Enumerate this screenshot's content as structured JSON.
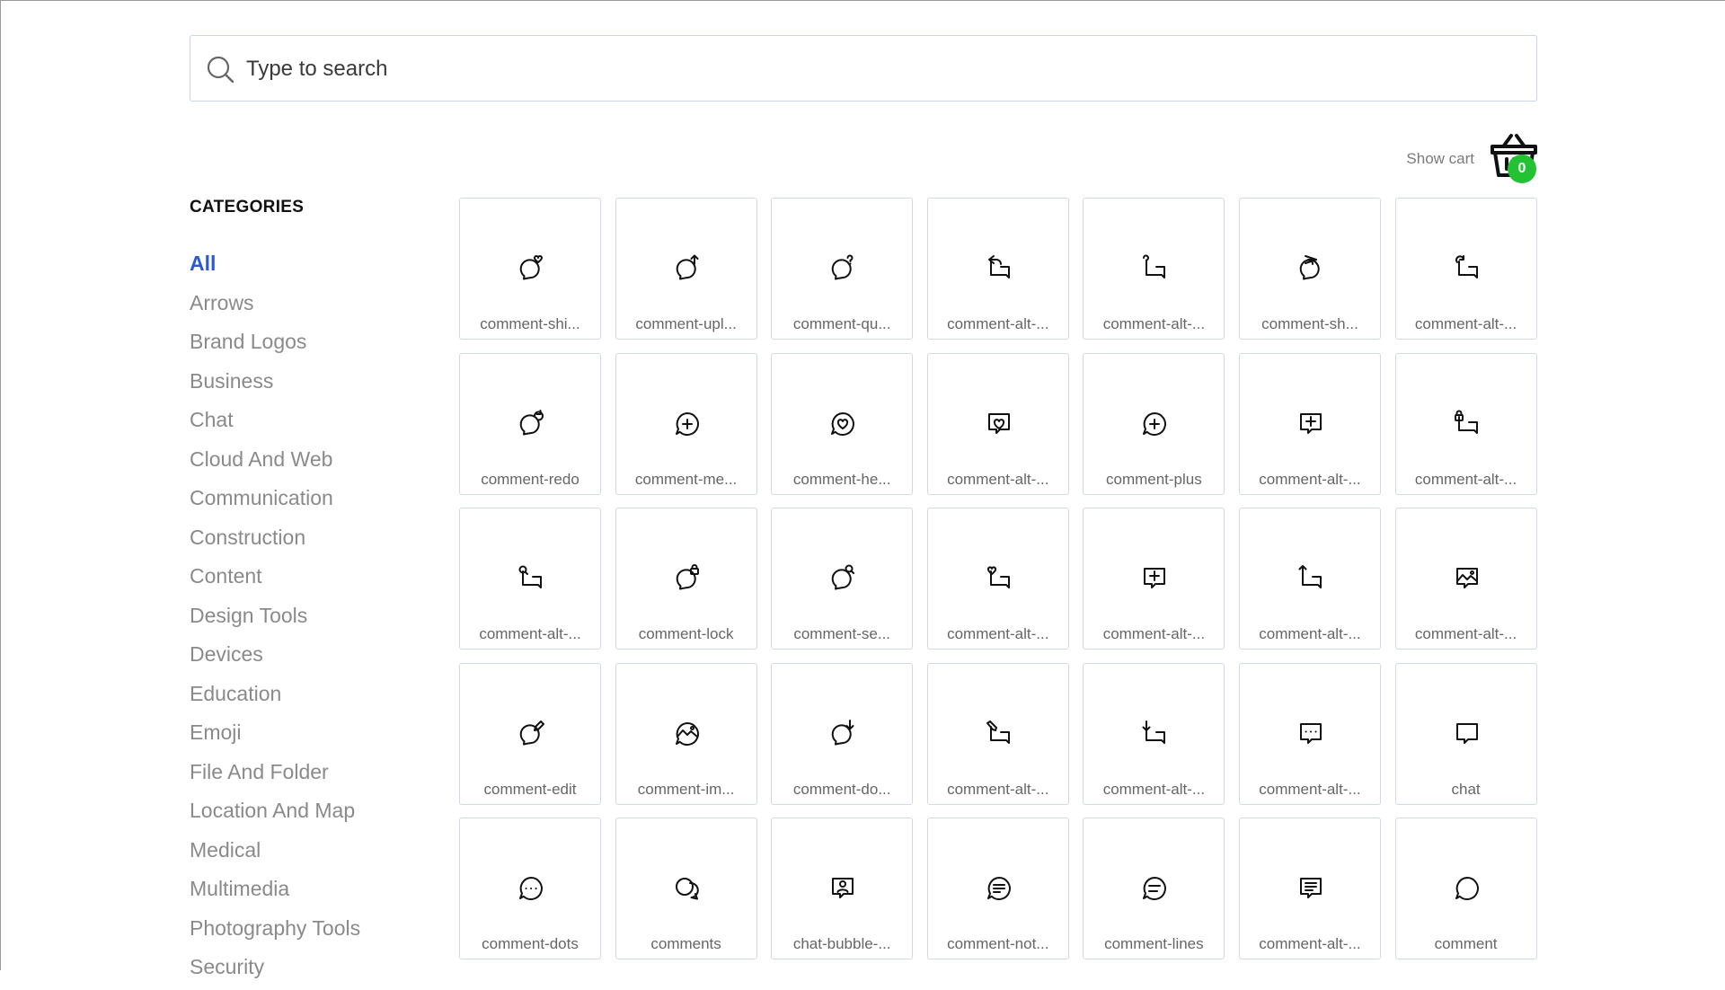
{
  "search": {
    "placeholder": "Type to search"
  },
  "cart": {
    "label": "Show cart",
    "count": "0"
  },
  "categories": {
    "title": "CATEGORIES",
    "items": [
      "All",
      "Arrows",
      "Brand Logos",
      "Business",
      "Chat",
      "Cloud And Web",
      "Communication",
      "Construction",
      "Content",
      "Design Tools",
      "Devices",
      "Education",
      "Emoji",
      "File And Folder",
      "Location And Map",
      "Medical",
      "Multimedia",
      "Photography Tools",
      "Security"
    ],
    "active": "All"
  },
  "icons": [
    {
      "label": "comment-shi...",
      "icon": "round-heart"
    },
    {
      "label": "comment-upl...",
      "icon": "round-up"
    },
    {
      "label": "comment-qu...",
      "icon": "round-question"
    },
    {
      "label": "comment-alt-...",
      "icon": "square-share"
    },
    {
      "label": "comment-alt-...",
      "icon": "square-question"
    },
    {
      "label": "comment-sh...",
      "icon": "round-share"
    },
    {
      "label": "comment-alt-...",
      "icon": "square-redo"
    },
    {
      "label": "comment-redo",
      "icon": "round-redo"
    },
    {
      "label": "comment-me...",
      "icon": "circle-plus"
    },
    {
      "label": "comment-he...",
      "icon": "circle-heart"
    },
    {
      "label": "comment-alt-...",
      "icon": "box-heart"
    },
    {
      "label": "comment-plus",
      "icon": "circle-plus"
    },
    {
      "label": "comment-alt-...",
      "icon": "box-plus"
    },
    {
      "label": "comment-alt-...",
      "icon": "square-lock"
    },
    {
      "label": "comment-alt-...",
      "icon": "square-search"
    },
    {
      "label": "comment-lock",
      "icon": "round-lock"
    },
    {
      "label": "comment-se...",
      "icon": "round-search"
    },
    {
      "label": "comment-alt-...",
      "icon": "square-heart"
    },
    {
      "label": "comment-alt-...",
      "icon": "box-plus"
    },
    {
      "label": "comment-alt-...",
      "icon": "square-up"
    },
    {
      "label": "comment-alt-...",
      "icon": "box-image"
    },
    {
      "label": "comment-edit",
      "icon": "round-edit"
    },
    {
      "label": "comment-im...",
      "icon": "circle-image"
    },
    {
      "label": "comment-do...",
      "icon": "round-down"
    },
    {
      "label": "comment-alt-...",
      "icon": "square-edit"
    },
    {
      "label": "comment-alt-...",
      "icon": "square-down"
    },
    {
      "label": "comment-alt-...",
      "icon": "box-dots"
    },
    {
      "label": "chat",
      "icon": "box-plain"
    },
    {
      "label": "comment-dots",
      "icon": "circle-dots"
    },
    {
      "label": "comments",
      "icon": "circles-double"
    },
    {
      "label": "chat-bubble-...",
      "icon": "box-user"
    },
    {
      "label": "comment-not...",
      "icon": "circle-notes"
    },
    {
      "label": "comment-lines",
      "icon": "circle-lines"
    },
    {
      "label": "comment-alt-...",
      "icon": "box-lines"
    },
    {
      "label": "comment",
      "icon": "circle-plain"
    }
  ]
}
